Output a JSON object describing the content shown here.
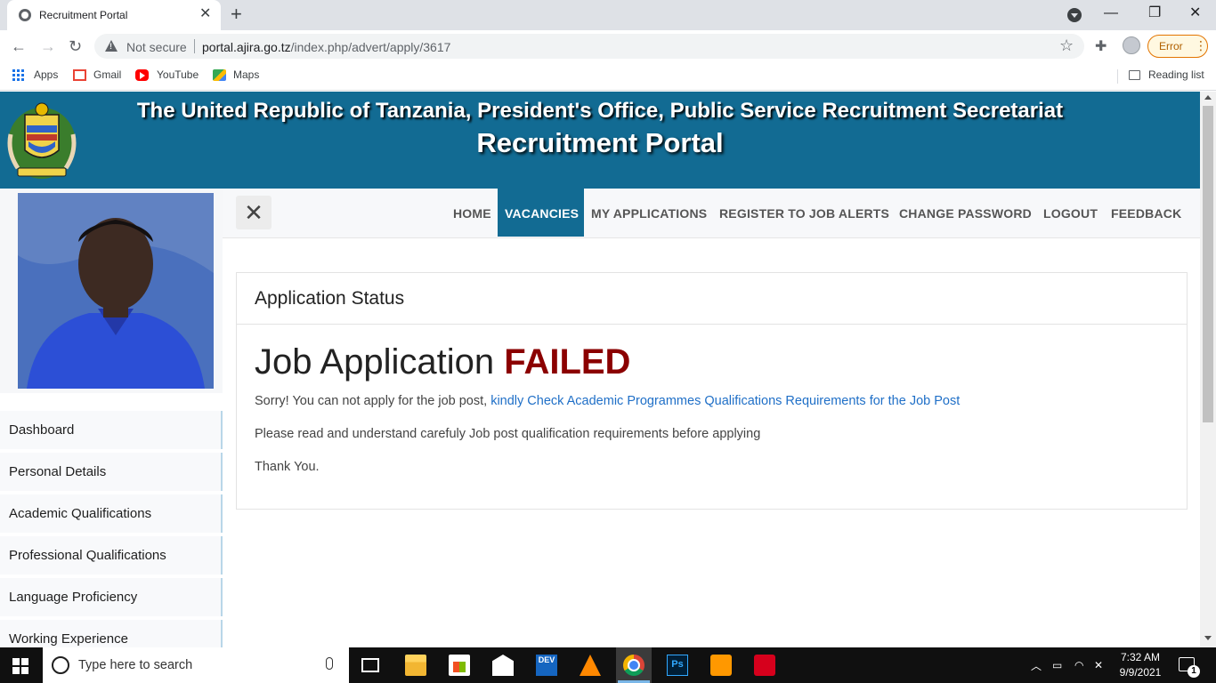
{
  "browser": {
    "tab_title": "Recruitment Portal",
    "not_secure": "Not secure",
    "url_host": "portal.ajira.go.tz",
    "url_path": "/index.php/advert/apply/3617",
    "error_label": "Error",
    "bookmarks": [
      "Apps",
      "Gmail",
      "YouTube",
      "Maps"
    ],
    "reading_list": "Reading list"
  },
  "header": {
    "line1": "The United Republic of Tanzania, President's Office, Public Service Recruitment Secretariat",
    "line2": "Recruitment Portal"
  },
  "sidebar": {
    "items": [
      {
        "label": "Dashboard"
      },
      {
        "label": "Personal Details"
      },
      {
        "label": "Academic Qualifications"
      },
      {
        "label": "Professional Qualifications"
      },
      {
        "label": "Language Proficiency"
      },
      {
        "label": "Working Experience"
      }
    ]
  },
  "nav": {
    "links": [
      {
        "label": "HOME"
      },
      {
        "label": "VACANCIES",
        "active": true
      },
      {
        "label": "MY APPLICATIONS"
      },
      {
        "label": "REGISTER TO JOB ALERTS"
      },
      {
        "label": "CHANGE PASSWORD"
      },
      {
        "label": "LOGOUT"
      },
      {
        "label": "FEEDBACK"
      }
    ]
  },
  "status": {
    "card_title": "Application Status",
    "heading_prefix": "Job Application",
    "heading_status": "FAILED",
    "message_prefix": "Sorry! You can not apply for the job post,",
    "message_link": "kindly Check Academic Programmes Qualifications Requirements for the Job Post",
    "message_2": "Please read and understand carefuly Job post qualification requirements before applying",
    "message_3": "Thank You."
  },
  "taskbar": {
    "search_placeholder": "Type here to search",
    "dev_label": "DEV",
    "ps_label": "Ps",
    "time": "7:32 AM",
    "date": "9/9/2021",
    "notification_count": "1"
  },
  "colors": {
    "brand": "#126b93",
    "failed": "#8b0000",
    "link": "#1f6fc7"
  }
}
